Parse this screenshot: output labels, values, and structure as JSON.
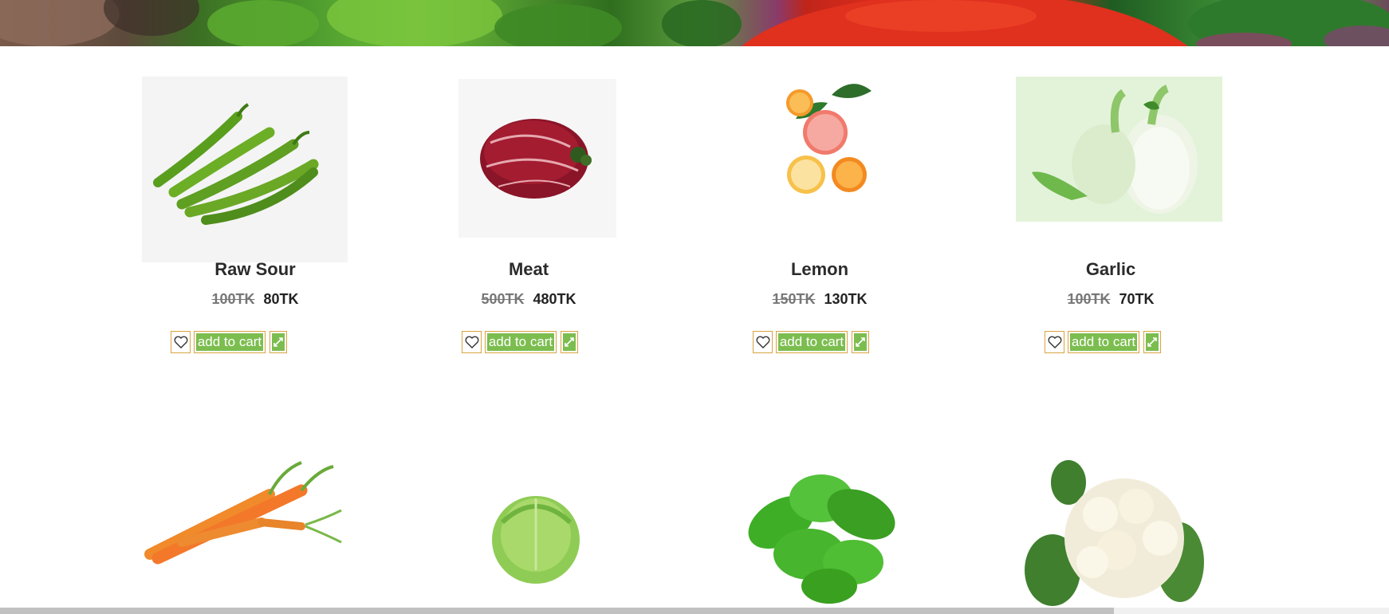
{
  "products_row1": [
    {
      "name": "Raw Sour",
      "old_price": "100TK",
      "price": "80TK",
      "image": "green-chili-image"
    },
    {
      "name": "Meat",
      "old_price": "500TK",
      "price": "480TK",
      "image": "beef-image"
    },
    {
      "name": "Lemon",
      "old_price": "150TK",
      "price": "130TK",
      "image": "citrus-image"
    },
    {
      "name": "Garlic",
      "old_price": "100TK",
      "price": "70TK",
      "image": "fennel-image"
    }
  ],
  "products_row2": [
    {
      "image": "carrot-image"
    },
    {
      "image": "cabbage-image"
    },
    {
      "image": "spinach-image"
    },
    {
      "image": "cauliflower-image"
    }
  ],
  "actions": {
    "wishlist_icon": "heart-icon",
    "add_to_cart_label": "add to cart",
    "compare_icon": "compare-icon"
  },
  "colors": {
    "button_green": "#7cbd4f",
    "button_border": "#d9a441"
  }
}
